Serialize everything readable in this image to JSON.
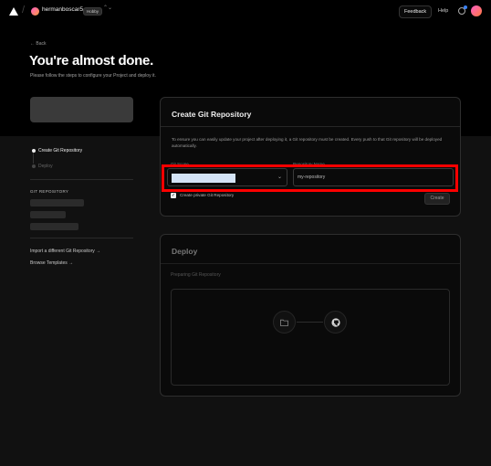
{
  "nav": {
    "username": "hermanboscar5",
    "plan_badge": "Hobby",
    "switcher_glyph": "⌃⌄",
    "feedback": "Feedback",
    "help": "Help"
  },
  "header": {
    "back": "← Back",
    "title": "You're almost done.",
    "subtitle": "Please follow the steps to configure your Project and deploy it."
  },
  "sidebar": {
    "steps": [
      {
        "label": "Create Git Repository",
        "active": true
      },
      {
        "label": "Deploy",
        "active": false
      }
    ],
    "git_repository_heading": "GIT REPOSITORY",
    "links": [
      "Import a different Git Repository →",
      "Browse Templates →"
    ]
  },
  "create_card": {
    "title": "Create Git Repository",
    "description": "To ensure you can easily update your project after deploying it, a Git repository must be created. Every push to that Git repository will be deployed automatically.",
    "git_scope_label": "Git Scope",
    "git_scope_value": "",
    "repo_name_label": "Repository Name",
    "repo_name_value": "my-repository",
    "private_checkbox_label": "Create private Git Repository",
    "private_checked": true,
    "create_button": "Create"
  },
  "deploy_card": {
    "title": "Deploy",
    "status": "Preparing Git Repository",
    "icons": [
      "folder-icon",
      "github-icon"
    ]
  },
  "colors": {
    "background": "#000000",
    "lower_background": "#111111",
    "highlight": "#ff0000",
    "accent_blue": "#3b82f6"
  }
}
